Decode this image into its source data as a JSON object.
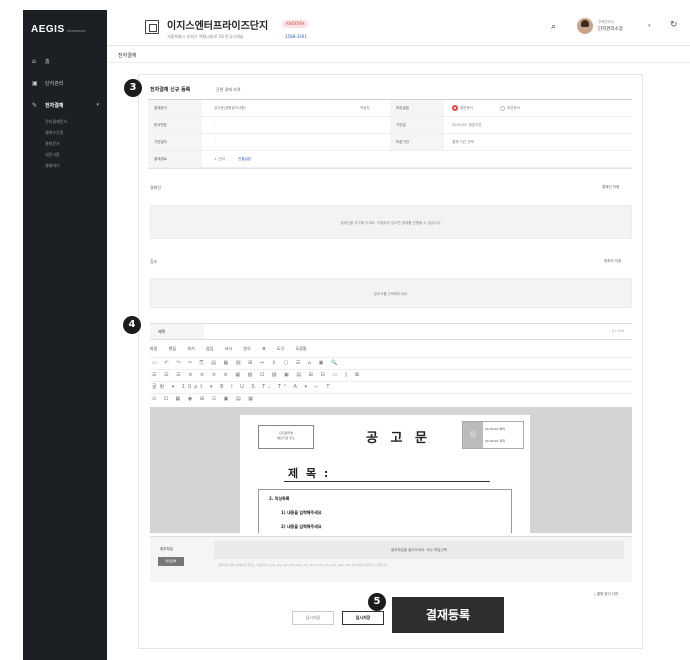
{
  "sidebar": {
    "logo": "AEGIS",
    "logo_sub": "ENTERPRISE",
    "items": [
      {
        "icon": "home-icon",
        "label": "홈"
      },
      {
        "icon": "building-icon",
        "label": "단지관리"
      },
      {
        "icon": "approval-icon",
        "label": "전자결재"
      }
    ],
    "sub_items": [
      "전자결재문서",
      "결재수신함",
      "결재문서",
      "내문서함",
      "결재대기"
    ]
  },
  "header": {
    "complex_name": "이지스엔터프라이즈단지",
    "badge": "ANDOOH",
    "address": "서울특별시 송파구 백제고분로 58 한국기계술",
    "phone": "1588-3301",
    "user_role": "주택관리사",
    "user_name": "단지관리소장"
  },
  "breadcrumb": "전자결재",
  "steps": {
    "s3": "3",
    "s4": "4",
    "s5": "5"
  },
  "section": {
    "title": "전자결재 신규 등록",
    "subtitle": "간편 결재 보관"
  },
  "form": {
    "row1": {
      "label1": "결재양식",
      "value1": "공고문(생활공지사항)",
      "label2": "작성자",
      "label3": "보존설정",
      "opt_on": "일반문서",
      "opt_off": "보관문서"
    },
    "row2": {
      "label1": "문서번호",
      "value1": "-",
      "label2": "기안일",
      "value2": "2023.05. 현장기안"
    },
    "row3": {
      "label1": "기안일자",
      "value1": "-",
      "label2": "보존기간",
      "value2": "결재 기간 선택"
    },
    "row4": {
      "label1": "결재경로",
      "value1": "1. 관리",
      "link1": "전결설정"
    }
  },
  "approval_area": {
    "label": "결재선",
    "add_link": "결재선 지정",
    "drop_text": "결재선을 추가해 주세요. 지정하지 않으면 결재를 진행할 수 없습니다."
  },
  "reference_area": {
    "label": "참조",
    "add_link": "참조자 지정",
    "drop_text": "참조자를 선택해주세요."
  },
  "title_field": {
    "label": "제목",
    "counter": "0 / 150"
  },
  "editor": {
    "menus": [
      "파일",
      "편집",
      "보기",
      "삽입",
      "서식",
      "양식",
      "표",
      "도구",
      "도움말"
    ],
    "toolbar1": "▭ ↶ ↷ ✂ ⎘ ▤ ▦ ▧ ⊞ ⇔ ⇕ ▢ ☰ ⌂ ▣ 🔍",
    "toolbar2": "☰ ☰ ☰ ≡ ≡ ≡ ≡ ▦ ▧ ⊡ ▨ ▣ ▤ ⊞ ⊟ ▭ ▯ ⊠",
    "toolbar3": "굴림 ▾ 10pt ▾ B I U S T₁ T² A ▾ ⌐ T",
    "toolbar4": "⊙ ⊡ ▦ ◉ ⊞ ☷ ▣ ▤ ▦"
  },
  "document": {
    "box_line1": "단지관리명",
    "box_line2": "발신기관 주소",
    "title": "공 고 문",
    "date_label1": "공고",
    "date_label2": "기간",
    "date1": "00.00.00 부터",
    "date2": "00.00.00 까지",
    "subject": "제 목 :",
    "h2": "2. 작성목록",
    "h3": "1) 내용을 입력해주세요",
    "h3b": "2) 내용을 입력해주세요"
  },
  "attachments": {
    "label": "첨부파일",
    "button": "파일첨부",
    "drop_text": "첨부파일을 끌어오세요. 또는 파일선택",
    "note": "첨부파일 최대 10개까지 업로드 가능합니다. jpg, png, gif, pdf, hwp, doc, docx, xls, xlsx, ppt, pptx, txt, zip 파일을 첨부할 수 있습니다."
  },
  "download_link": "결재 양식 다운",
  "buttons": {
    "cancel": "임시저장",
    "temp_save": "임시저장",
    "submit": "결재등록"
  },
  "colors": {
    "sidebar": "#1c1f24",
    "submit": "#2e2e2e",
    "accent_red": "#e04848",
    "link_blue": "#2a61c9"
  }
}
